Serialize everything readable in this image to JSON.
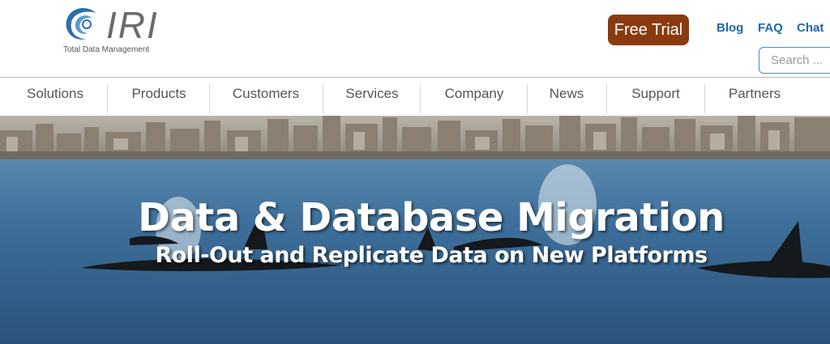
{
  "brand": {
    "name": "IRI",
    "tagline": "Total Data Management",
    "logo_icon": "swirl-logo-icon",
    "color": "#2b6ea8"
  },
  "header": {
    "cta": {
      "label": "Free Trial",
      "color": "#8b3a10"
    },
    "links": [
      {
        "label": "Blog"
      },
      {
        "label": "FAQ"
      },
      {
        "label": "Chat"
      }
    ],
    "link_color": "#1e6aa6",
    "search": {
      "placeholder": "Search ...",
      "value": ""
    }
  },
  "nav": {
    "items": [
      {
        "label": "Solutions"
      },
      {
        "label": "Products"
      },
      {
        "label": "Customers"
      },
      {
        "label": "Services"
      },
      {
        "label": "Company"
      },
      {
        "label": "News"
      },
      {
        "label": "Support"
      },
      {
        "label": "Partners"
      }
    ]
  },
  "hero": {
    "title": "Data & Database Migration",
    "subtitle": "Roll-Out and Replicate Data on New Platforms",
    "background": "city-skyline-water-orcas-photo"
  }
}
